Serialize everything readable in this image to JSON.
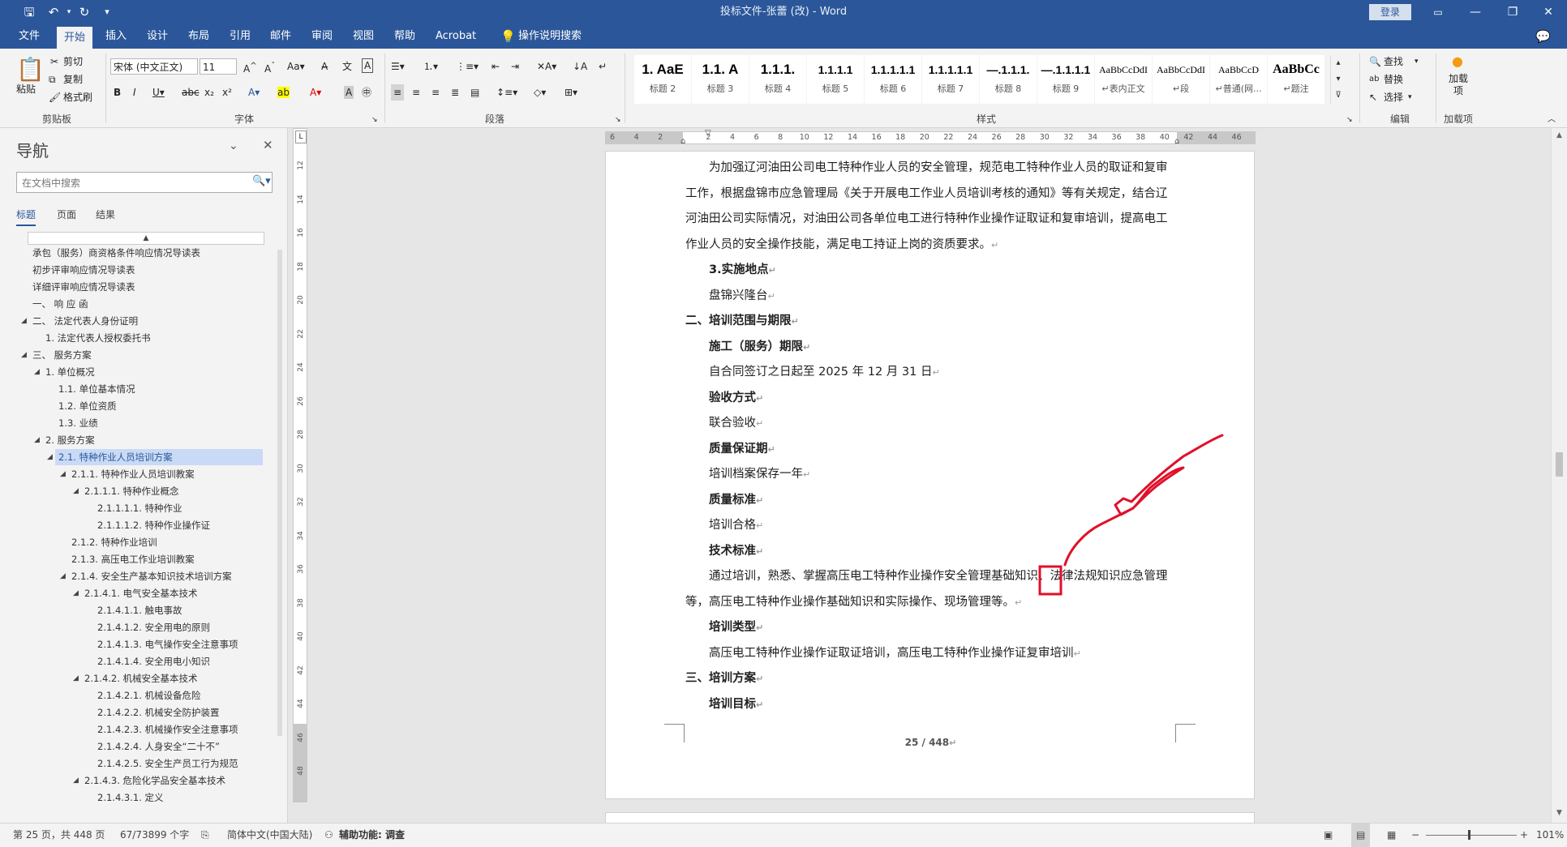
{
  "window": {
    "title": "投标文件-张蕾 (改) - Word",
    "login": "登录",
    "quick_access": [
      "save-icon",
      "undo-icon",
      "redo-icon",
      "customize-icon"
    ]
  },
  "tabs": [
    "文件",
    "开始",
    "插入",
    "设计",
    "布局",
    "引用",
    "邮件",
    "审阅",
    "视图",
    "帮助",
    "Acrobat",
    "操作说明搜索"
  ],
  "ribbon": {
    "clipboard": {
      "paste": "粘贴",
      "cut": "剪切",
      "copy": "复制",
      "format_painter": "格式刷",
      "label": "剪贴板"
    },
    "font": {
      "name": "宋体 (中文正文)",
      "size": "11",
      "label": "字体"
    },
    "paragraph": {
      "label": "段落"
    },
    "styles": {
      "label": "样式",
      "items": [
        {
          "sample": "1. AaE",
          "name": "标题 2"
        },
        {
          "sample": "1.1. A",
          "name": "标题 3"
        },
        {
          "sample": "1.1.1.",
          "name": "标题 4"
        },
        {
          "sample": "1.1.1.1",
          "name": "标题 5"
        },
        {
          "sample": "1.1.1.1.1",
          "name": "标题 6"
        },
        {
          "sample": "1.1.1.1.1",
          "name": "标题 7"
        },
        {
          "sample": "—.1.1.1.",
          "name": "标题 8"
        },
        {
          "sample": "—.1.1.1.1",
          "name": "标题 9"
        },
        {
          "sample": "AaBbCcDdI",
          "name": "↵表内正文"
        },
        {
          "sample": "AaBbCcDdI",
          "name": "↵段"
        },
        {
          "sample": "AaBbCcD",
          "name": "↵普通(网..."
        },
        {
          "sample": "AaBbCc",
          "name": "↵题注"
        }
      ]
    },
    "editing": {
      "find": "查找",
      "replace": "替换",
      "select": "选择",
      "label": "编辑"
    },
    "addins": {
      "button": "加载项",
      "label": "加载项"
    }
  },
  "nav": {
    "title": "导航",
    "search_placeholder": "在文档中搜索",
    "tabs": [
      "标题",
      "页面",
      "结果"
    ],
    "items": [
      {
        "text": "承包（服务）商资格条件响应情况导读表",
        "level": 0,
        "tri": ""
      },
      {
        "text": "初步评审响应情况导读表",
        "level": 0,
        "tri": ""
      },
      {
        "text": "详细评审响应情况导读表",
        "level": 0,
        "tri": ""
      },
      {
        "text": "一、 响 应 函",
        "level": 0,
        "tri": ""
      },
      {
        "text": "二、 法定代表人身份证明",
        "level": 0,
        "tri": "◢"
      },
      {
        "text": "1. 法定代表人授权委托书",
        "level": 1,
        "tri": ""
      },
      {
        "text": "三、 服务方案",
        "level": 0,
        "tri": "◢"
      },
      {
        "text": "1. 单位概况",
        "level": 1,
        "tri": "◢"
      },
      {
        "text": "1.1. 单位基本情况",
        "level": 2,
        "tri": ""
      },
      {
        "text": "1.2. 单位资质",
        "level": 2,
        "tri": ""
      },
      {
        "text": "1.3. 业绩",
        "level": 2,
        "tri": ""
      },
      {
        "text": "2. 服务方案",
        "level": 1,
        "tri": "◢"
      },
      {
        "text": "2.1. 特种作业人员培训方案",
        "level": 2,
        "tri": "◢",
        "selected": true
      },
      {
        "text": "2.1.1. 特种作业人员培训教案",
        "level": 3,
        "tri": "◢"
      },
      {
        "text": "2.1.1.1. 特种作业概念",
        "level": 4,
        "tri": "◢"
      },
      {
        "text": "2.1.1.1.1. 特种作业",
        "level": 5,
        "tri": ""
      },
      {
        "text": "2.1.1.1.2. 特种作业操作证",
        "level": 5,
        "tri": ""
      },
      {
        "text": "2.1.2. 特种作业培训",
        "level": 3,
        "tri": ""
      },
      {
        "text": "2.1.3. 高压电工作业培训教案",
        "level": 3,
        "tri": ""
      },
      {
        "text": "2.1.4. 安全生产基本知识技术培训方案",
        "level": 3,
        "tri": "◢"
      },
      {
        "text": "2.1.4.1.  电气安全基本技术",
        "level": 4,
        "tri": "◢"
      },
      {
        "text": "2.1.4.1.1. 触电事故",
        "level": 5,
        "tri": ""
      },
      {
        "text": "2.1.4.1.2. 安全用电的原则",
        "level": 5,
        "tri": ""
      },
      {
        "text": "2.1.4.1.3. 电气操作安全注意事项",
        "level": 5,
        "tri": ""
      },
      {
        "text": "2.1.4.1.4. 安全用电小知识",
        "level": 5,
        "tri": ""
      },
      {
        "text": "2.1.4.2.  机械安全基本技术",
        "level": 4,
        "tri": "◢"
      },
      {
        "text": "2.1.4.2.1. 机械设备危险",
        "level": 5,
        "tri": ""
      },
      {
        "text": "2.1.4.2.2. 机械安全防护装置",
        "level": 5,
        "tri": ""
      },
      {
        "text": "2.1.4.2.3. 机械操作安全注意事项",
        "level": 5,
        "tri": ""
      },
      {
        "text": "2.1.4.2.4. 人身安全“二十不”",
        "level": 5,
        "tri": ""
      },
      {
        "text": "2.1.4.2.5. 安全生产员工行为规范",
        "level": 5,
        "tri": ""
      },
      {
        "text": "2.1.4.3.  危险化学品安全基本技术",
        "level": 4,
        "tri": "◢"
      },
      {
        "text": "2.1.4.3.1. 定义",
        "level": 5,
        "tri": ""
      }
    ]
  },
  "hruler": [
    "6",
    "4",
    "2",
    "",
    "2",
    "4",
    "6",
    "8",
    "10",
    "12",
    "14",
    "16",
    "18",
    "20",
    "22",
    "24",
    "26",
    "28",
    "30",
    "32",
    "34",
    "36",
    "38",
    "40",
    "42",
    "44",
    "46"
  ],
  "vruler": [
    "12",
    "14",
    "16",
    "18",
    "20",
    "22",
    "24",
    "26",
    "28",
    "30",
    "32",
    "34",
    "36",
    "38",
    "40",
    "42",
    "44",
    "46",
    "48"
  ],
  "document": {
    "paragraphs": [
      {
        "text": "为加强辽河油田公司电工特种作业人员的安全管理，规范电工特种作业人员的取证和复审",
        "indent": true,
        "bold": false,
        "mark": false
      },
      {
        "text": "工作，根据盘锦市应急管理局《关于开展电工作业人员培训考核的通知》等有关规定，结合辽",
        "indent": false,
        "bold": false,
        "mark": false
      },
      {
        "text": "河油田公司实际情况，对油田公司各单位电工进行特种作业操作证取证和复审培训，提高电工",
        "indent": false,
        "bold": false,
        "mark": false
      },
      {
        "text": "作业人员的安全操作技能，满足电工持证上岗的资质要求。",
        "indent": false,
        "bold": false,
        "mark": true
      },
      {
        "text": "3.实施地点",
        "indent": true,
        "bold": true,
        "mark": true
      },
      {
        "text": "盘锦兴隆台",
        "indent": true,
        "bold": false,
        "mark": true
      },
      {
        "text": "二、培训范围与期限",
        "indent": false,
        "bold": true,
        "mark": true
      },
      {
        "text": "施工（服务）期限",
        "indent": true,
        "bold": true,
        "mark": true
      },
      {
        "text": "自合同签订之日起至 2025 年 12 月 31 日",
        "indent": true,
        "bold": false,
        "mark": true
      },
      {
        "text": "验收方式",
        "indent": true,
        "bold": true,
        "mark": true
      },
      {
        "text": "联合验收",
        "indent": true,
        "bold": false,
        "mark": true
      },
      {
        "text": "质量保证期",
        "indent": true,
        "bold": true,
        "mark": true
      },
      {
        "text": "培训档案保存一年",
        "indent": true,
        "bold": false,
        "mark": true
      },
      {
        "text": "质量标准",
        "indent": true,
        "bold": true,
        "mark": true
      },
      {
        "text": "培训合格",
        "indent": true,
        "bold": false,
        "mark": true
      },
      {
        "text": "技术标准",
        "indent": true,
        "bold": true,
        "mark": true
      },
      {
        "text": "通过培训，熟悉、掌握高压电工特种作业操作安全管理基础知识、法律法规知识应急管理",
        "indent": true,
        "bold": false,
        "mark": false
      },
      {
        "text": "等，高压电工特种作业操作基础知识和实际操作、现场管理等。",
        "indent": false,
        "bold": false,
        "mark": true
      },
      {
        "text": "培训类型",
        "indent": true,
        "bold": true,
        "mark": true
      },
      {
        "text": "高压电工特种作业操作证取证培训，高压电工特种作业操作证复审培训",
        "indent": true,
        "bold": false,
        "mark": true
      },
      {
        "text": "三、培训方案",
        "indent": false,
        "bold": true,
        "mark": true
      },
      {
        "text": "培训目标",
        "indent": true,
        "bold": true,
        "mark": true
      }
    ],
    "page_number": "25 / 448",
    "paragraph_mark": "↵"
  },
  "annotation_color": "#e0102a",
  "accent": "#2b579a",
  "status": {
    "page": "第 25 页，共 448 页",
    "words": "67/73899 个字",
    "language": "简体中文(中国大陆)",
    "accessibility": "辅助功能: 调查",
    "zoom": "101%"
  }
}
